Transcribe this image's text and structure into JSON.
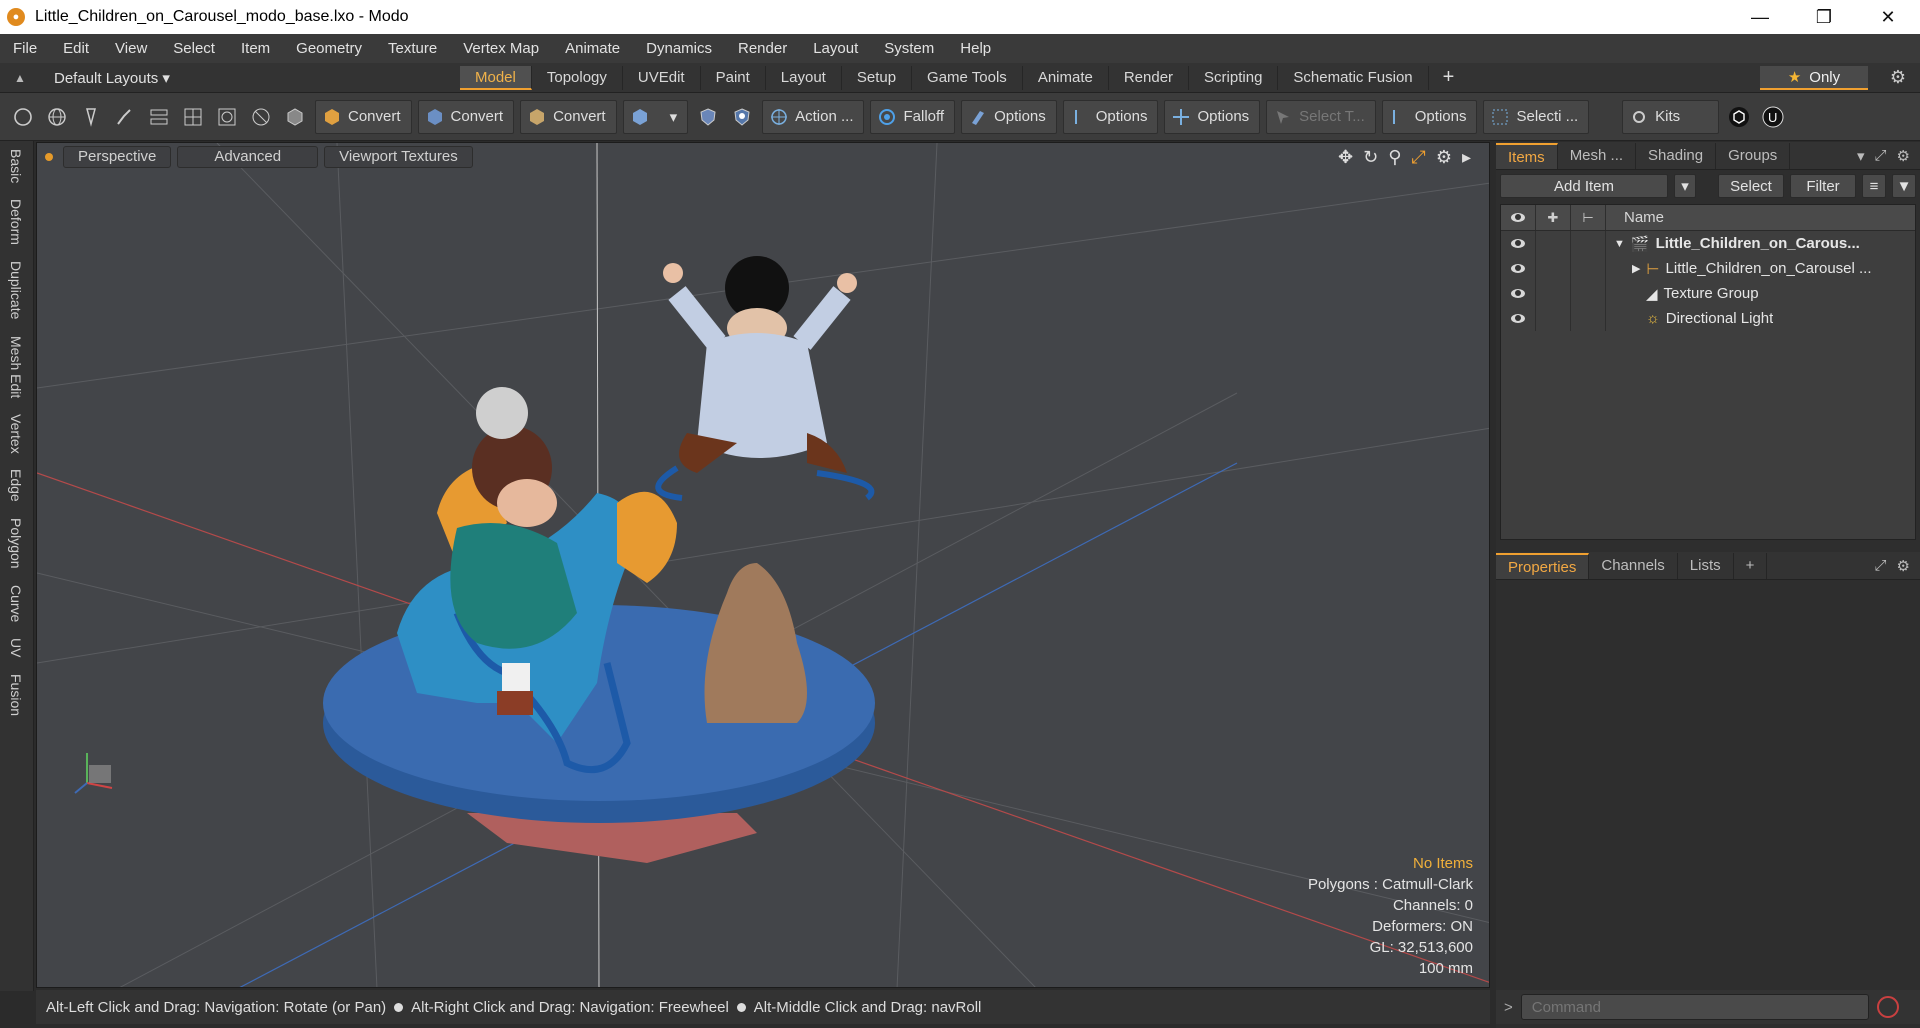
{
  "window": {
    "title": "Little_Children_on_Carousel_modo_base.lxo - Modo",
    "minimize": "—",
    "restore": "❐",
    "close": "✕"
  },
  "menu": [
    "File",
    "Edit",
    "View",
    "Select",
    "Item",
    "Geometry",
    "Texture",
    "Vertex Map",
    "Animate",
    "Dynamics",
    "Render",
    "Layout",
    "System",
    "Help"
  ],
  "layout_row": {
    "layouts_label": "Default Layouts ▾",
    "tabs": [
      "Model",
      "Topology",
      "UVEdit",
      "Paint",
      "Layout",
      "Setup",
      "Game Tools",
      "Animate",
      "Render",
      "Scripting",
      "Schematic Fusion"
    ],
    "active_tab": "Model",
    "add": "+",
    "only_label": "Only"
  },
  "toolbar": {
    "convert1": "Convert",
    "convert2": "Convert",
    "convert3": "Convert",
    "action": "Action ...",
    "falloff": "Falloff",
    "options1": "Options",
    "options2": "Options",
    "options3": "Options",
    "select_t": "Select T...",
    "options4": "Options",
    "selecti": "Selecti ...",
    "kits": "Kits"
  },
  "left_tabs": [
    "Basic",
    "Deform",
    "Duplicate",
    "Mesh Edit",
    "Vertex",
    "Edge",
    "Polygon",
    "Curve",
    "UV",
    "Fusion"
  ],
  "viewport": {
    "tabs": [
      "Perspective",
      "Advanced",
      "Viewport Textures"
    ],
    "info": {
      "no_items": "No Items",
      "polygons": "Polygons : Catmull-Clark",
      "channels": "Channels: 0",
      "deformers": "Deformers: ON",
      "gl": "GL: 32,513,600",
      "scale": "100 mm"
    }
  },
  "status": {
    "hint1": "Alt-Left Click and Drag: Navigation: Rotate (or Pan)",
    "hint2": "Alt-Right Click and Drag: Navigation: Freewheel",
    "hint3": "Alt-Middle Click and Drag: navRoll"
  },
  "items_panel": {
    "tabs": [
      "Items",
      "Mesh ...",
      "Shading",
      "Groups"
    ],
    "add_item": "Add Item",
    "select": "Select",
    "filter": "Filter",
    "name_header": "Name",
    "rows": [
      {
        "label": "Little_Children_on_Carous...",
        "bold": true
      },
      {
        "label": "Little_Children_on_Carousel ...",
        "bold": false
      },
      {
        "label": "Texture Group",
        "bold": false
      },
      {
        "label": "Directional Light",
        "bold": false
      }
    ]
  },
  "props_panel": {
    "tabs": [
      "Properties",
      "Channels",
      "Lists"
    ],
    "add": "+"
  },
  "command": {
    "placeholder": "Command"
  },
  "colors": {
    "accent": "#f0a030",
    "carousel_base": "#3a6bb0",
    "viewport_bg": "#434549"
  }
}
